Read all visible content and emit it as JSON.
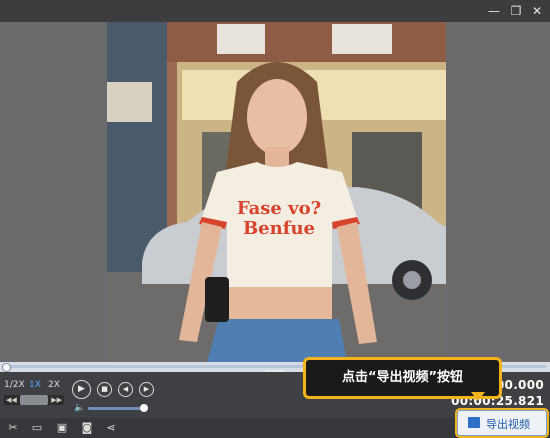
{
  "window": {
    "minimize_icon": "minimize-icon",
    "restore_icon": "restore-icon",
    "close_icon": "close-icon"
  },
  "video": {
    "shirt_text_line1": "Fase vo?",
    "shirt_text_line2": "Benfue"
  },
  "speed": {
    "options": [
      "1/2X",
      "1X",
      "2X"
    ],
    "selected": "1X",
    "accent": "#4aa3ff"
  },
  "playback": {
    "play_icon": "play-icon",
    "stop_icon": "stop-icon",
    "prev_icon": "previous-frame-icon",
    "next_icon": "next-frame-icon"
  },
  "volume": {
    "level": 0.9
  },
  "time": {
    "current": "00:00:00.000",
    "total": "00:00:25.821"
  },
  "tooltip": {
    "text": "点击“导出视频”按钮",
    "border_color": "#f3b41b"
  },
  "footer": {
    "export_label": "导出视频",
    "icons": [
      "cut-icon",
      "open-folder-icon",
      "save-icon",
      "snapshot-icon",
      "share-icon"
    ]
  }
}
